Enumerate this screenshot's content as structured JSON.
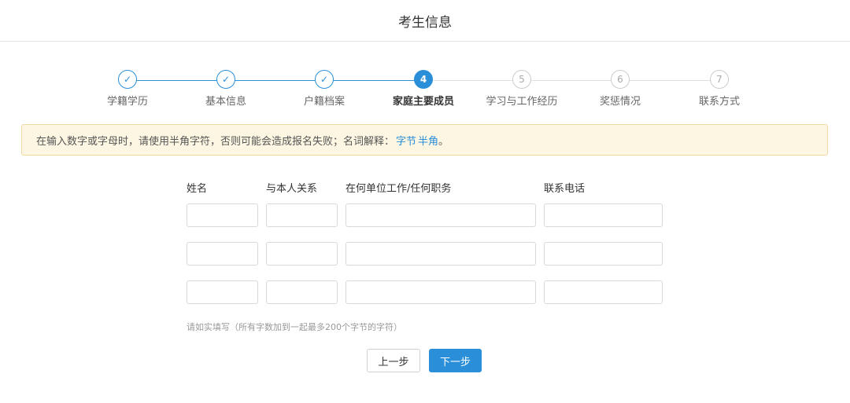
{
  "header": {
    "title": "考生信息"
  },
  "steps": [
    {
      "label": "学籍学历",
      "number": "✓",
      "status": "done"
    },
    {
      "label": "基本信息",
      "number": "✓",
      "status": "done"
    },
    {
      "label": "户籍档案",
      "number": "✓",
      "status": "done"
    },
    {
      "label": "家庭主要成员",
      "number": "4",
      "status": "active"
    },
    {
      "label": "学习与工作经历",
      "number": "5",
      "status": "todo"
    },
    {
      "label": "奖惩情况",
      "number": "6",
      "status": "todo"
    },
    {
      "label": "联系方式",
      "number": "7",
      "status": "todo"
    }
  ],
  "notice": {
    "text": "在输入数字或字母时，请使用半角字符，否则可能会造成报名失败；名词解释：",
    "link1": "字节",
    "link2": "半角",
    "end": "。"
  },
  "table": {
    "columns": [
      "姓名",
      "与本人关系",
      "在何单位工作/任何职务",
      "联系电话"
    ],
    "rows": [
      {
        "name": "",
        "relation": "",
        "workplace": "",
        "phone": ""
      },
      {
        "name": "",
        "relation": "",
        "workplace": "",
        "phone": ""
      },
      {
        "name": "",
        "relation": "",
        "workplace": "",
        "phone": ""
      }
    ]
  },
  "hint": "请如实填写（所有字数加到一起最多200个字节的字符）",
  "buttons": {
    "prev": "上一步",
    "next": "下一步"
  },
  "colors": {
    "accent": "#2a8fd8",
    "notice_bg": "#fdf6e3",
    "notice_border": "#f3d9a4"
  }
}
